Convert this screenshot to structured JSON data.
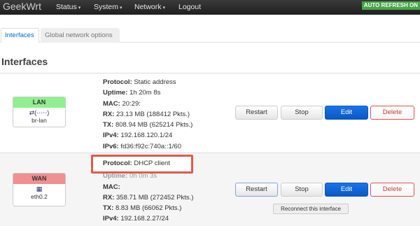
{
  "navbar": {
    "brand": "GeekWrt",
    "items": [
      {
        "label": "Status",
        "caret": "▾"
      },
      {
        "label": "System",
        "caret": "▾"
      },
      {
        "label": "Network",
        "caret": "▾"
      },
      {
        "label": "Logout",
        "caret": ""
      }
    ],
    "auto_refresh": "AUTO REFRESH ON"
  },
  "tabs": [
    {
      "label": "Interfaces",
      "active": true
    },
    {
      "label": "Global network options",
      "active": false
    }
  ],
  "section_title": "Interfaces",
  "interfaces": [
    {
      "name": "LAN",
      "device": "br-lan",
      "icon": "network-bridge-icon",
      "details": {
        "protocol_label": "Protocol:",
        "protocol": "Static address",
        "uptime_label": "Uptime:",
        "uptime": "1h 20m 8s",
        "mac_label": "MAC:",
        "mac": "20:29:",
        "rx_label": "RX:",
        "rx": "23.13 MB (188412 Pkts.)",
        "tx_label": "TX:",
        "tx": "808.94 MB (625214 Pkts.)",
        "ipv4_label": "IPv4:",
        "ipv4": "192.168.120.1/24",
        "ipv6_label": "IPv6:",
        "ipv6": "fd36:f92c:740a::1/60"
      }
    },
    {
      "name": "WAN",
      "device": "eth0.2",
      "icon": "ethernet-port-icon",
      "details": {
        "protocol_label": "Protocol:",
        "protocol": "DHCP client",
        "uptime_label": "Uptime:",
        "uptime": "0h 0m 3s",
        "mac_label": "MAC:",
        "mac": "",
        "rx_label": "RX:",
        "rx": "358.71 MB (272452 Pkts.)",
        "tx_label": "TX:",
        "tx": "8.83 MB (66062 Pkts.)",
        "ipv4_label": "IPv4:",
        "ipv4": "192.168.2.27/24"
      }
    }
  ],
  "buttons": {
    "restart": "Restart",
    "stop": "Stop",
    "edit": "Edit",
    "delete": "Delete"
  },
  "tooltip": "Reconnect this interface",
  "colors": {
    "lan_header": "#90f090",
    "wan_header": "#f09090",
    "edit_button": "#1a73e8",
    "delete_text": "#c43c35",
    "highlight_border": "#e05a4a",
    "auto_refresh_bg": "#46a546"
  }
}
